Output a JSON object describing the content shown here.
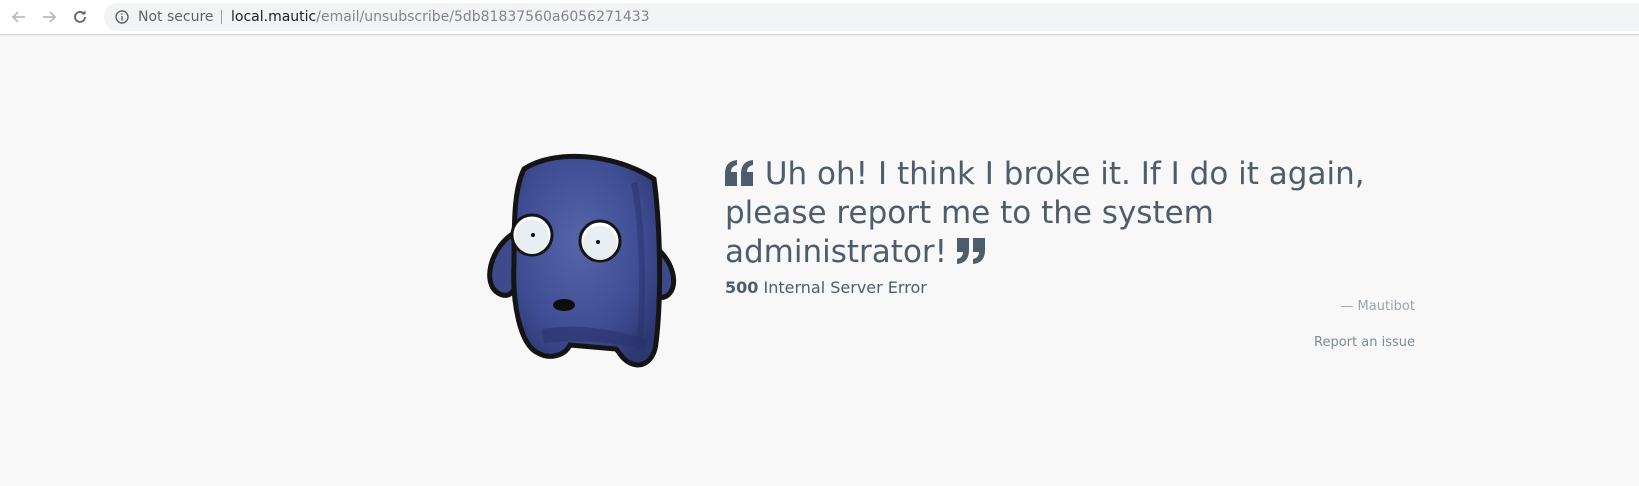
{
  "browser": {
    "security_label": "Not secure",
    "url_host": "local.mautic",
    "url_path": "/email/unsubscribe/5db81837560a6056271433"
  },
  "error_page": {
    "message": "Uh oh! I think I broke it. If I do it again, please report me to the system administrator!",
    "error_code": "500",
    "error_text": "Internal Server Error",
    "attribution": "— Mautibot",
    "report_link": "Report an issue"
  },
  "colors": {
    "text": "#4e5d6c",
    "muted": "#9aa5b1",
    "mascot_body": "#3b4a8c",
    "background": "#f8f8f8"
  }
}
